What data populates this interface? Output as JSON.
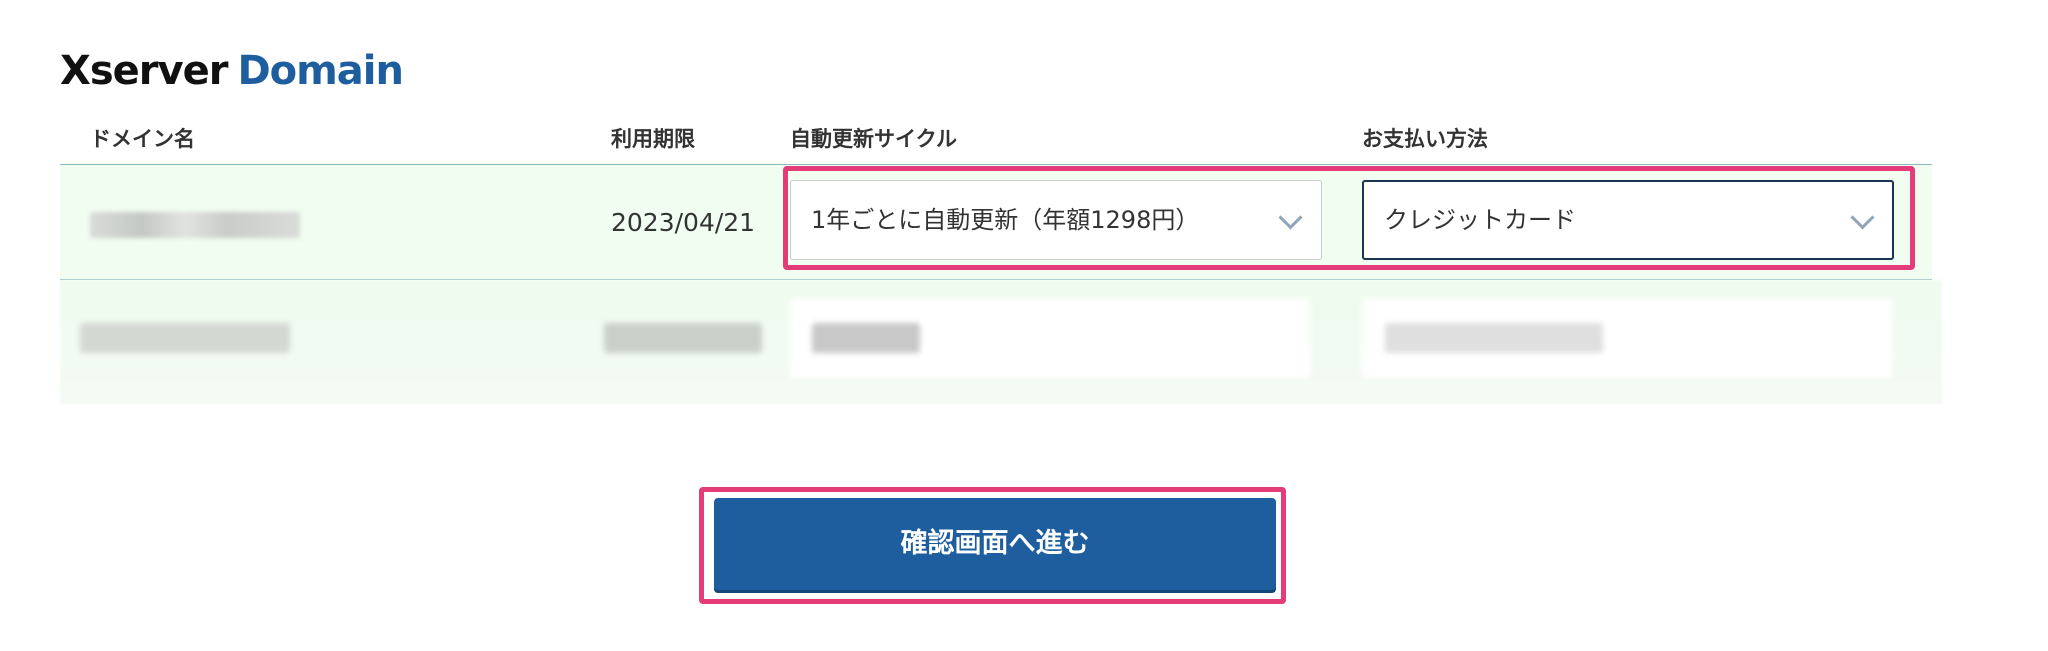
{
  "logo": {
    "brand": "Xserver",
    "product": "Domain"
  },
  "columns": {
    "domain_name": "ドメイン名",
    "expiry": "利用期限",
    "renew_cycle": "自動更新サイクル",
    "payment_method": "お支払い方法"
  },
  "rows": [
    {
      "expiry": "2023/04/21",
      "renew_cycle": "1年ごとに自動更新（年額1298円）",
      "payment_method": "クレジットカード"
    }
  ],
  "actions": {
    "confirm_label": "確認画面へ進む"
  },
  "colors": {
    "brand_blue": "#1e5d9e",
    "highlight": "#e33c79",
    "row_background": "#f0fdf0"
  },
  "icons": {
    "select_arrow": "chevron-down-icon"
  }
}
